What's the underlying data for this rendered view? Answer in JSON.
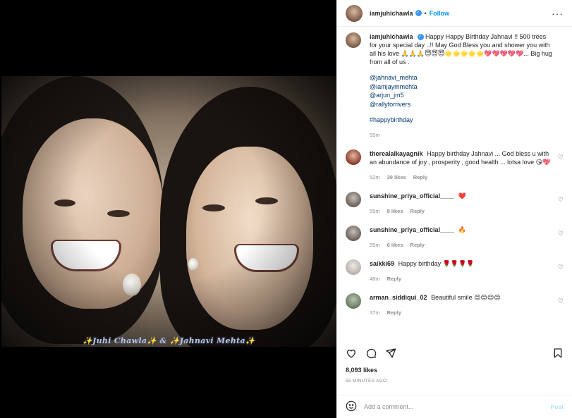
{
  "header": {
    "username": "iamjuhichawla",
    "dot": "•",
    "follow_label": "Follow",
    "more": "···"
  },
  "media": {
    "caption": "✨Juhi Chawla✨ & ✨Jahnavi Mehta✨"
  },
  "post": {
    "username": "iamjuhichawla",
    "text": "Happy Happy Birthday Jahnavi !! 500 trees for your special day ..!! May God Bless you and shower you with all his love 🙏🙏🙏😇😇😇🌟🌟🌟🌟🌟💖💖💖💖💖... Big hug from all of us .",
    "mentions": [
      "@jahnavi_mehta",
      "@iamjaymmehta",
      "@arjun_jm5",
      "@rallyforrivers"
    ],
    "hashtag": "#happybirthday",
    "time": "55m"
  },
  "comments": [
    {
      "username": "therealalkayagnik",
      "text": "Happy birthday Jahnavi ... God bless u with an abundance of joy , prosperity , good health ... lotsa love 😘💖",
      "time": "52m",
      "likes": "39 likes",
      "reply": "Reply"
    },
    {
      "username": "sunshine_priya_official____",
      "text": "❤️",
      "time": "55m",
      "likes": "8 likes",
      "reply": "Reply"
    },
    {
      "username": "sunshine_priya_official____",
      "text": "🔥",
      "time": "55m",
      "likes": "6 likes",
      "reply": "Reply"
    },
    {
      "username": "saikki69",
      "text": "Happy birthday 🌹🌹🌹🌹",
      "time": "48m",
      "likes": "",
      "reply": "Reply"
    },
    {
      "username": "arman_siddiqui_02",
      "text": "Beautiful smile 😊😊😊😊",
      "time": "37m",
      "likes": "",
      "reply": "Reply"
    }
  ],
  "footer": {
    "likes": "8,093 likes",
    "time": "55 MINUTES AGO",
    "comment_placeholder": "Add a comment...",
    "post_label": "Post"
  },
  "icons": {
    "like": "heart-outline-icon",
    "comment": "comment-bubble-icon",
    "share": "paper-plane-icon",
    "save": "bookmark-icon",
    "emoji": "smiley-icon",
    "verified": "verified-badge-icon"
  },
  "colors": {
    "link": "#0095f6",
    "mention": "#00376b",
    "muted": "#8e8e8e",
    "verified": "#3897f0"
  }
}
